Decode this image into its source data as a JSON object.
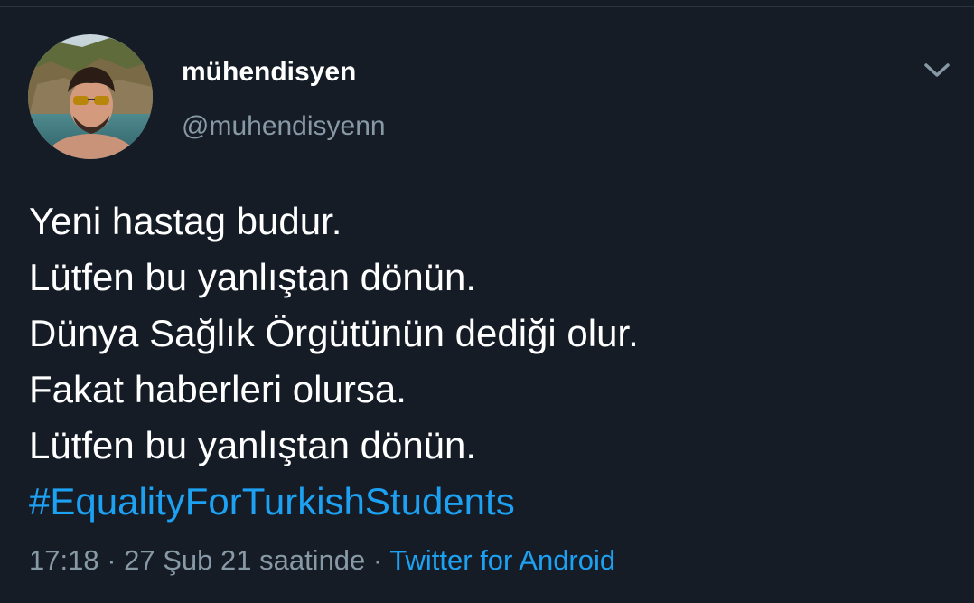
{
  "tweet": {
    "author": {
      "display_name": "mühendisyen",
      "handle": "@muhendisyenn"
    },
    "menu_icon": "chevron-down-icon",
    "lines": [
      "Yeni hastag budur.",
      "Lütfen bu yanlıştan dönün.",
      "Dünya Sağlık Örgütünün dediği olur.",
      "Fakat haberleri olursa.",
      "Lütfen bu yanlıştan dönün."
    ],
    "hashtag": "#EqualityForTurkishStudents",
    "timestamp": "17:18 · 27 Şub 21 saatinde",
    "separator": " · ",
    "source": "Twitter for Android"
  },
  "colors": {
    "background": "#151c26",
    "text": "#ffffff",
    "secondary_text": "#8899a6",
    "link": "#1da1f2"
  }
}
